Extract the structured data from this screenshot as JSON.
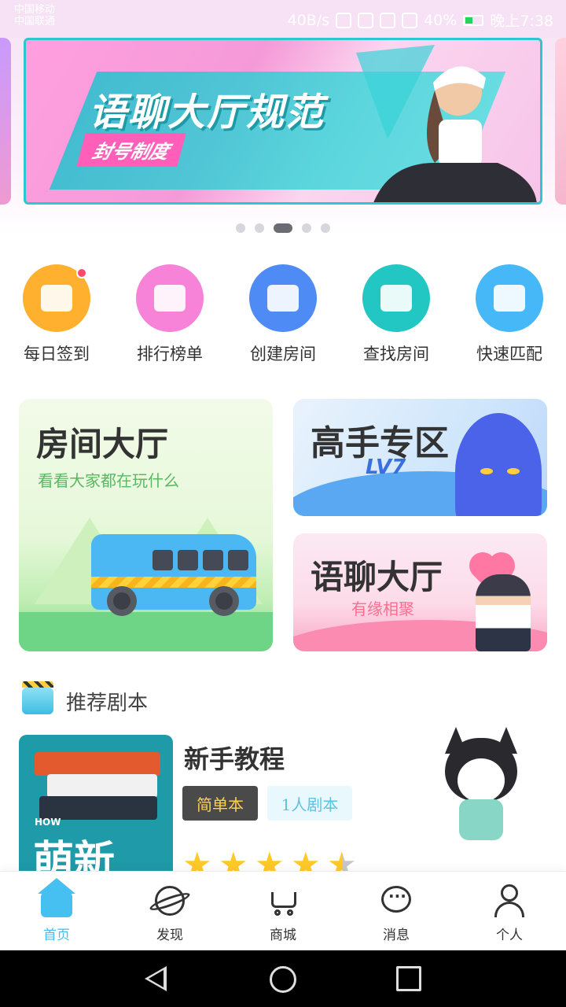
{
  "status_bar": {
    "carrier_1": "中国移动",
    "carrier_2": "中国联通",
    "speed": "40B/s",
    "battery": "40%",
    "time": "晚上7:38"
  },
  "banner": {
    "title": "语聊大厅规范",
    "subtitle": "封号制度",
    "page_count": 5,
    "active_index": 2
  },
  "actions": [
    {
      "label": "每日签到",
      "color": "#ffb02e",
      "badge": true
    },
    {
      "label": "排行榜单",
      "color": "#f783d8",
      "badge": false
    },
    {
      "label": "创建房间",
      "color": "#4f8bf5",
      "badge": false
    },
    {
      "label": "查找房间",
      "color": "#22c7c4",
      "badge": false
    },
    {
      "label": "快速匹配",
      "color": "#46b8f7",
      "badge": false
    }
  ],
  "cards": {
    "hall": {
      "title": "房间大厅",
      "subtitle": "看看大家都在玩什么"
    },
    "pro": {
      "title": "高手专区",
      "level": "LV7"
    },
    "voice": {
      "title": "语聊大厅",
      "subtitle": "有缘相聚"
    }
  },
  "recommend": {
    "header": "推荐剧本",
    "script": {
      "cover_small": "HOW",
      "cover_title": "萌新",
      "title": "新手教程",
      "tag_difficulty": "简单本",
      "tag_players": "1人剧本",
      "rating": 4.5
    }
  },
  "tabbar": [
    {
      "label": "首页",
      "icon": "home-icon",
      "active": true
    },
    {
      "label": "发现",
      "icon": "planet-icon",
      "active": false
    },
    {
      "label": "商城",
      "icon": "cart-icon",
      "active": false
    },
    {
      "label": "消息",
      "icon": "chat-icon",
      "active": false
    },
    {
      "label": "个人",
      "icon": "person-icon",
      "active": false
    }
  ],
  "colors": {
    "accent": "#3fbef0"
  }
}
